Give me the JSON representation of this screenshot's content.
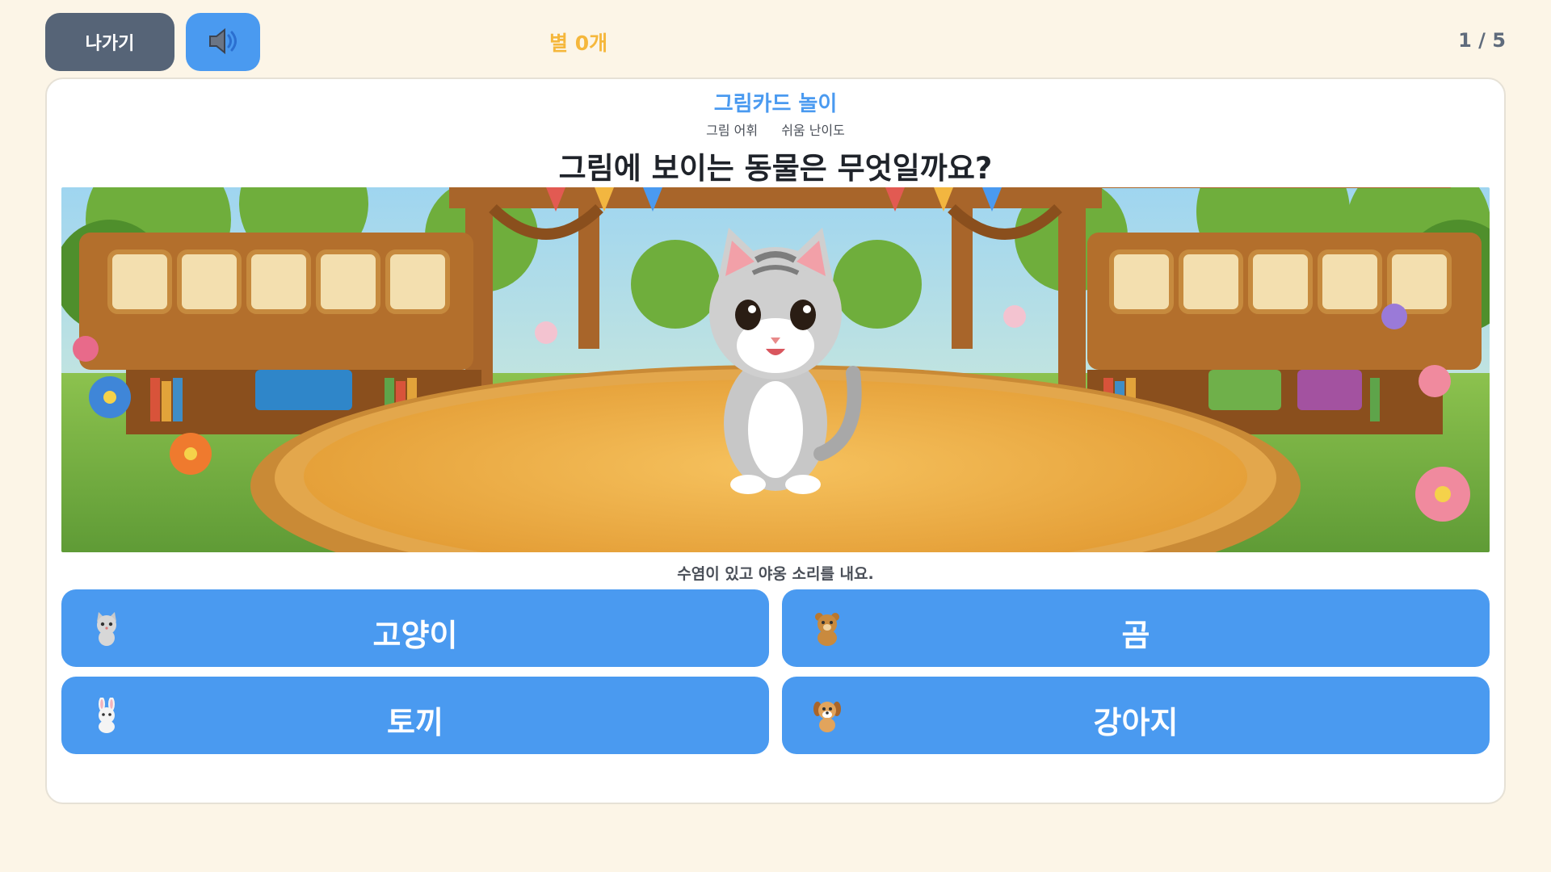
{
  "toolbar": {
    "exit_label": "나가기",
    "sound_icon": "speaker-icon",
    "stars_label": "별 0개",
    "progress_label": "1 / 5"
  },
  "quiz": {
    "game_title": "그림카드 놀이",
    "category": "그림 어휘",
    "difficulty": "쉬움 난이도",
    "question": "그림에 보이는 동물은 무엇일까요?",
    "hint": "수염이 있고 야옹 소리를 내요.",
    "choices": [
      {
        "label": "고양이",
        "icon": "cat-icon"
      },
      {
        "label": "곰",
        "icon": "bear-icon"
      },
      {
        "label": "토끼",
        "icon": "rabbit-icon"
      },
      {
        "label": "강아지",
        "icon": "dog-icon"
      }
    ]
  },
  "colors": {
    "background": "#fcf5e7",
    "accent": "#4a9af0",
    "exit_button": "#566477",
    "stars": "#f5b73c"
  }
}
